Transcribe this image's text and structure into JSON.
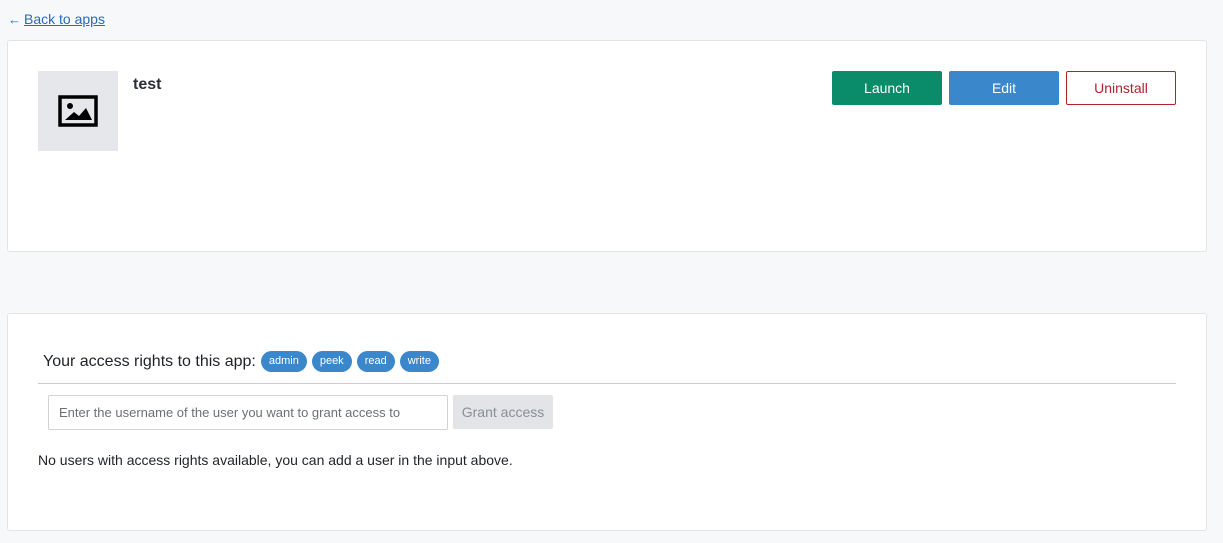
{
  "nav": {
    "back_arrow": "←",
    "back_label": "Back to apps"
  },
  "app": {
    "name": "test",
    "thumbnail_icon": "image-placeholder-icon"
  },
  "actions": {
    "launch_label": "Launch",
    "edit_label": "Edit",
    "uninstall_label": "Uninstall"
  },
  "access": {
    "heading": "Your access rights to this app:",
    "rights": [
      "admin",
      "peek",
      "read",
      "write"
    ],
    "input_placeholder": "Enter the username of the user you want to grant access to",
    "input_value": "",
    "grant_label": "Grant access",
    "empty_message": "No users with access rights available, you can add a user in the input above."
  },
  "colors": {
    "launch": "#0a8c6a",
    "edit": "#3a87cc",
    "uninstall": "#b3222d",
    "badge": "#3a87cc",
    "link": "#2a6bb5"
  }
}
